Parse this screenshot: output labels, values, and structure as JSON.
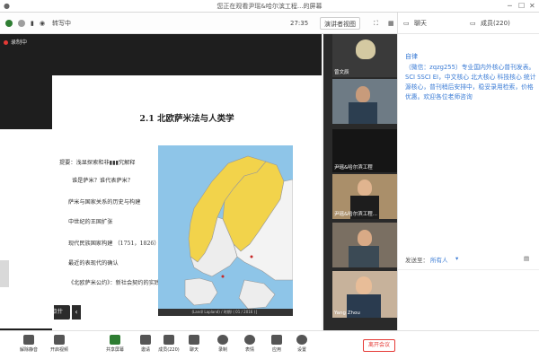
{
  "window": {
    "title": "您正在观看尹瑶&哈尔滨工程...的屏幕"
  },
  "toolbar": {
    "speaking_label": "转写中",
    "time": "27:35",
    "view_label": "演讲者视图",
    "chat_label": "聊天",
    "members_label": "成员(220)"
  },
  "stage": {
    "recording_label": "录制中",
    "slide": {
      "title": "2.1 北欧萨米法与人类学",
      "lines": [
        "提要：浅显探索和非▮▮▮究解释",
        "谁是萨米？谁代表萨米？",
        "萨米与国家关系的历史与构建",
        "中世纪的王国扩张",
        "现代民族国家构建 （1751，1826）",
        "最近的表现代的确认",
        "《北欧萨米公约》：新社会契约的实践？"
      ],
      "map_caption": "(Land/ Lapland) / 时期/ ( 01 / 2016 ) ▏"
    },
    "say_button_label": "说点什么..."
  },
  "participants": [
    {
      "name": "曾文辰"
    },
    {
      "name": ""
    },
    {
      "name": "尹瑶&哈尔滨工程"
    },
    {
      "name": "尹瑶&哈尔滨工程..."
    },
    {
      "name": ""
    },
    {
      "name": "Yang Zhou"
    }
  ],
  "chat": {
    "sender": "自律",
    "message": "（微信：zqzg255）专业国内外核心普刊发表。SCI SSCI EI，中文核心 北大核心 科技核心 统计源核心，普刊稍后安排中，稳妥录用检索，价格优惠。欢迎各位老师咨询",
    "send_to_label": "发送至：",
    "send_to_target": "所有人"
  },
  "bottombar": {
    "buttons": [
      {
        "label": "解除静音",
        "icon": "mic-icon"
      },
      {
        "label": "开启视频",
        "icon": "video-icon"
      },
      {
        "label": "共享屏幕",
        "icon": "share-screen-icon"
      },
      {
        "label": "邀请",
        "icon": "invite-icon"
      },
      {
        "label": "成员(220)",
        "icon": "members-icon"
      },
      {
        "label": "聊天",
        "icon": "chat-icon"
      },
      {
        "label": "录制",
        "icon": "record-icon"
      },
      {
        "label": "表情",
        "icon": "emoji-icon"
      },
      {
        "label": "应用",
        "icon": "apps-icon"
      },
      {
        "label": "设置",
        "icon": "settings-icon"
      }
    ],
    "end_label": "离开会议"
  },
  "colors": {
    "accent": "#3a7bd5",
    "danger": "#e53935",
    "map_yellow": "#f2d34b",
    "map_sea": "#8ec5e8"
  }
}
